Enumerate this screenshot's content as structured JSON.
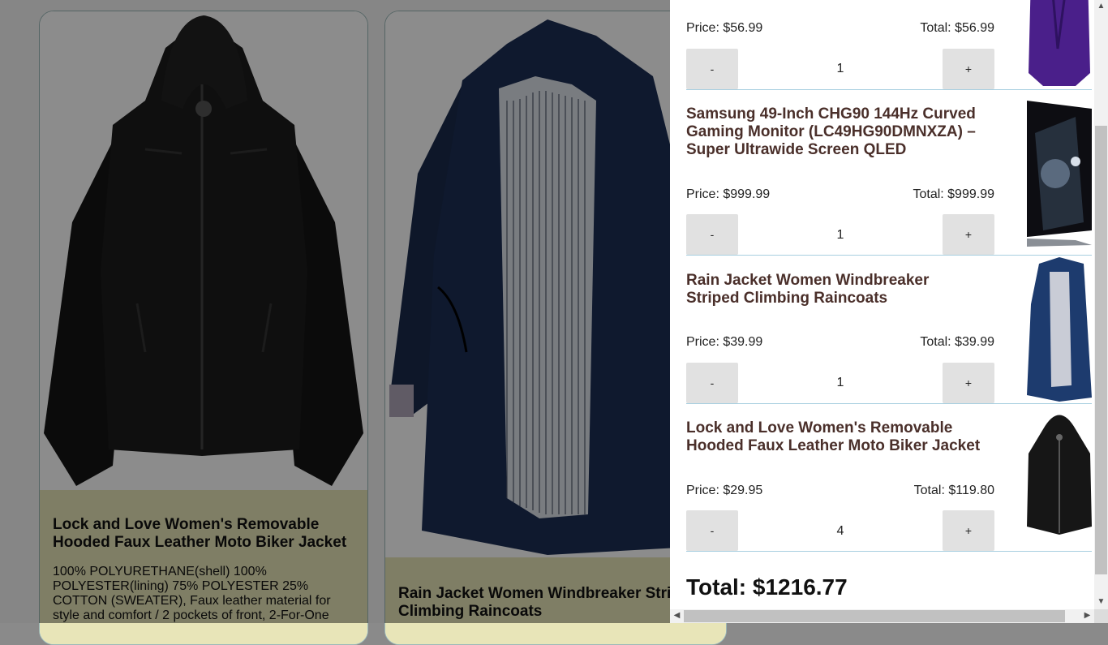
{
  "products": [
    {
      "title": "Lock and Love Women's Removable Hooded Faux Leather Moto Biker Jacket",
      "description": "100% POLYURETHANE(shell) 100% POLYESTER(lining) 75% POLYESTER 25% COTTON (SWEATER), Faux leather material for style and comfort / 2 pockets of front, 2-For-One"
    },
    {
      "title": "Rain Jacket Women Windbreaker Striped Climbing Raincoats"
    }
  ],
  "cart": {
    "items": [
      {
        "title": "",
        "price": "Price: $56.99",
        "total": "Total: $56.99",
        "qty": "1",
        "minus": "-",
        "plus": "+",
        "thumb": "purple-jacket-thumbnail"
      },
      {
        "title": "Samsung 49-Inch CHG90 144Hz Curved Gaming Monitor (LC49HG90DMNXZA) – Super Ultrawide Screen QLED",
        "price": "Price: $999.99",
        "total": "Total: $999.99",
        "qty": "1",
        "minus": "-",
        "plus": "+",
        "thumb": "monitor-thumbnail"
      },
      {
        "title": "Rain Jacket Women Windbreaker Striped Climbing Raincoats",
        "price": "Price: $39.99",
        "total": "Total: $39.99",
        "qty": "1",
        "minus": "-",
        "plus": "+",
        "thumb": "navy-raincoat-thumbnail"
      },
      {
        "title": "Lock and Love Women's Removable Hooded Faux Leather Moto Biker Jacket",
        "price": "Price: $29.95",
        "total": "Total: $119.80",
        "qty": "4",
        "minus": "-",
        "plus": "+",
        "thumb": "black-leather-jacket-thumbnail"
      }
    ],
    "total": "Total: $1216.77"
  },
  "colors": {
    "card_info_bg": "#e8e5b8",
    "cart_title": "#4a2f2a",
    "divider": "#a8cfe0",
    "button_bg": "#e1e1e1"
  }
}
